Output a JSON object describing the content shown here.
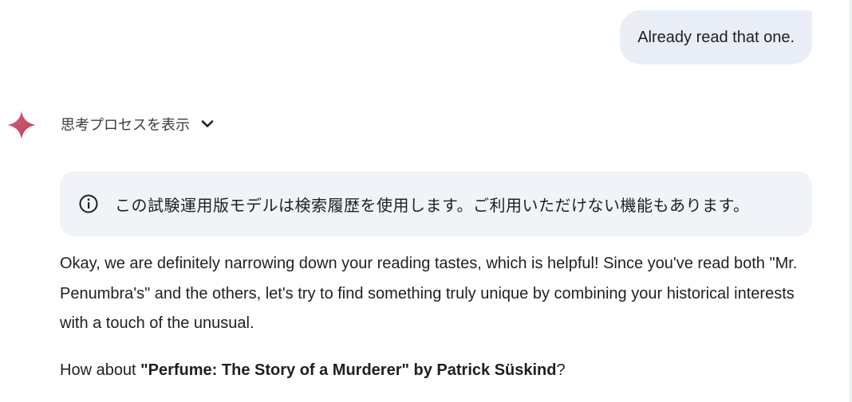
{
  "user_message": "Already read that one.",
  "thoughts_toggle": {
    "label": "思考プロセスを表示",
    "icon": "chevron-down-icon"
  },
  "notice": {
    "icon": "info-icon",
    "text": "この試験運用版モデルは検索履歴を使用します。ご利用いただけない機能もあります。"
  },
  "response": {
    "paragraph1": "Okay, we are definitely narrowing down your reading tastes, which is helpful! Since you've read both \"Mr. Penumbra's\" and the others, let's try to find something truly unique by combining your historical interests with a touch of the unusual.",
    "paragraph2": {
      "prefix": "How about ",
      "bold": "\"Perfume: The Story of a Murderer\" by Patrick Süskind",
      "suffix": "?"
    }
  },
  "colors": {
    "user_bubble_bg": "#e9eef6",
    "notice_bg": "#f0f4f9",
    "spark_color": "#c5485f",
    "text": "#1f1f1f"
  }
}
